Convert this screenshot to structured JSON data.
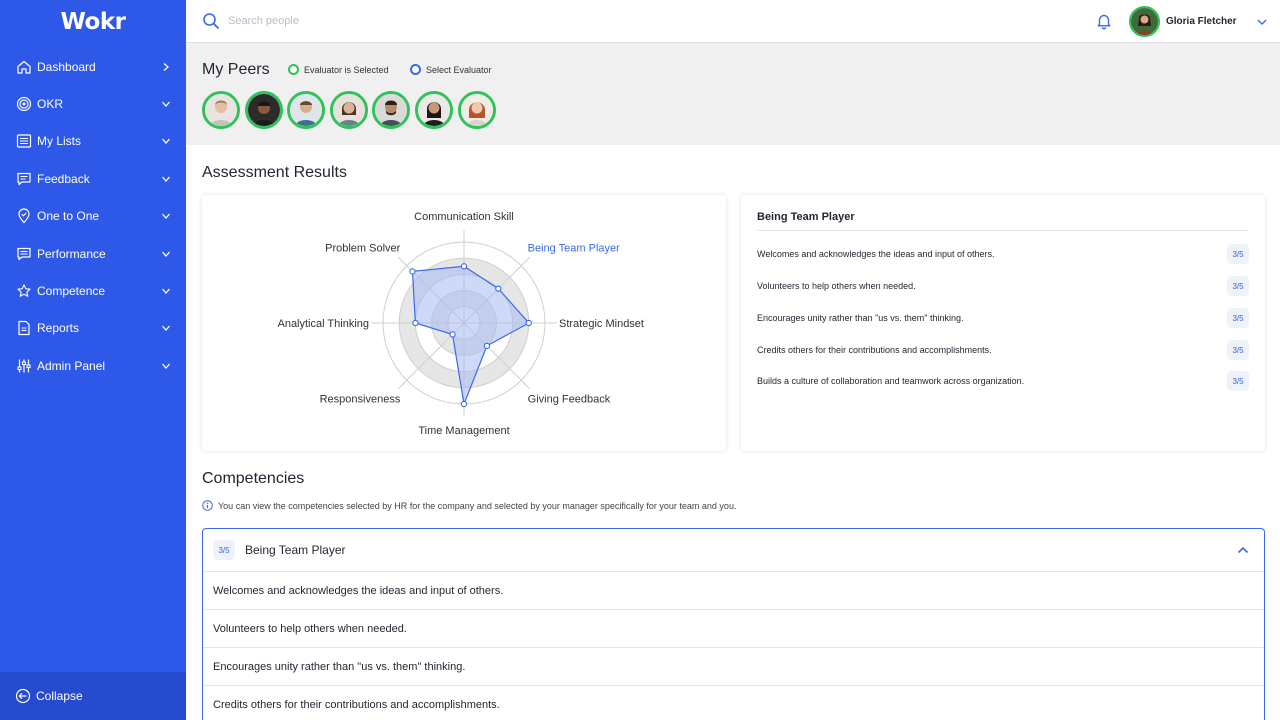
{
  "app": {
    "logo": "Wokr"
  },
  "sidebar": {
    "items": [
      {
        "label": "Dashboard",
        "icon": "home-icon",
        "chevron": "right"
      },
      {
        "label": "OKR",
        "icon": "target-icon",
        "chevron": "down"
      },
      {
        "label": "My Lists",
        "icon": "list-icon",
        "chevron": "down"
      },
      {
        "label": "Feedback",
        "icon": "chat-icon",
        "chevron": "down"
      },
      {
        "label": "One to One",
        "icon": "map-pin-icon",
        "chevron": "down"
      },
      {
        "label": "Performance",
        "icon": "comment-icon",
        "chevron": "down"
      },
      {
        "label": "Competence",
        "icon": "star-icon",
        "chevron": "down"
      },
      {
        "label": "Reports",
        "icon": "document-icon",
        "chevron": "down"
      },
      {
        "label": "Admin Panel",
        "icon": "sliders-icon",
        "chevron": "down"
      }
    ],
    "collapse_label": "Collapse"
  },
  "header": {
    "search_placeholder": "Search people",
    "user_name": "Gloria Fletcher"
  },
  "peers": {
    "title": "My Peers",
    "legend_selected": "Evaluator is Selected",
    "legend_select": "Select Evaluator",
    "count": 7
  },
  "assessment": {
    "title": "Assessment Results",
    "radar": {
      "axes": [
        "Communication Skill",
        "Being Team Player",
        "Strategic Mindset",
        "Giving Feedback",
        "Time Management",
        "Responsiveness",
        "Analytical Thinking",
        "Problem Solver"
      ],
      "highlighted": "Being Team Player",
      "values": [
        3.5,
        3,
        4,
        2,
        5,
        1,
        3,
        4.5
      ],
      "max": 5
    },
    "detail": {
      "title": "Being Team Player",
      "items": [
        {
          "text": "Welcomes and acknowledges the ideas and input of others.",
          "score": "3/5"
        },
        {
          "text": "Volunteers to help others when needed.",
          "score": "3/5"
        },
        {
          "text": "Encourages unity rather than \"us vs. them\" thinking.",
          "score": "3/5"
        },
        {
          "text": "Credits others for their contributions and accomplishments.",
          "score": "3/5"
        },
        {
          "text": "Builds a culture of collaboration and teamwork across organization.",
          "score": "3/5"
        }
      ]
    }
  },
  "competencies": {
    "title": "Competencies",
    "info": "You can view the competencies selected by HR for the company and selected by your manager specifically for your team and you.",
    "expanded": {
      "score": "3/5",
      "name": "Being Team Player",
      "rows": [
        "Welcomes and acknowledges the ideas and input of others.",
        "Volunteers to help others when needed.",
        "Encourages unity rather than \"us vs. them\" thinking.",
        "Credits others for their contributions and accomplishments."
      ]
    }
  },
  "colors": {
    "sidebar": "#2e58e8",
    "accent": "#3a6ae8",
    "selected_green": "#2fc25b",
    "radar_fill": "#a9b8f2"
  }
}
